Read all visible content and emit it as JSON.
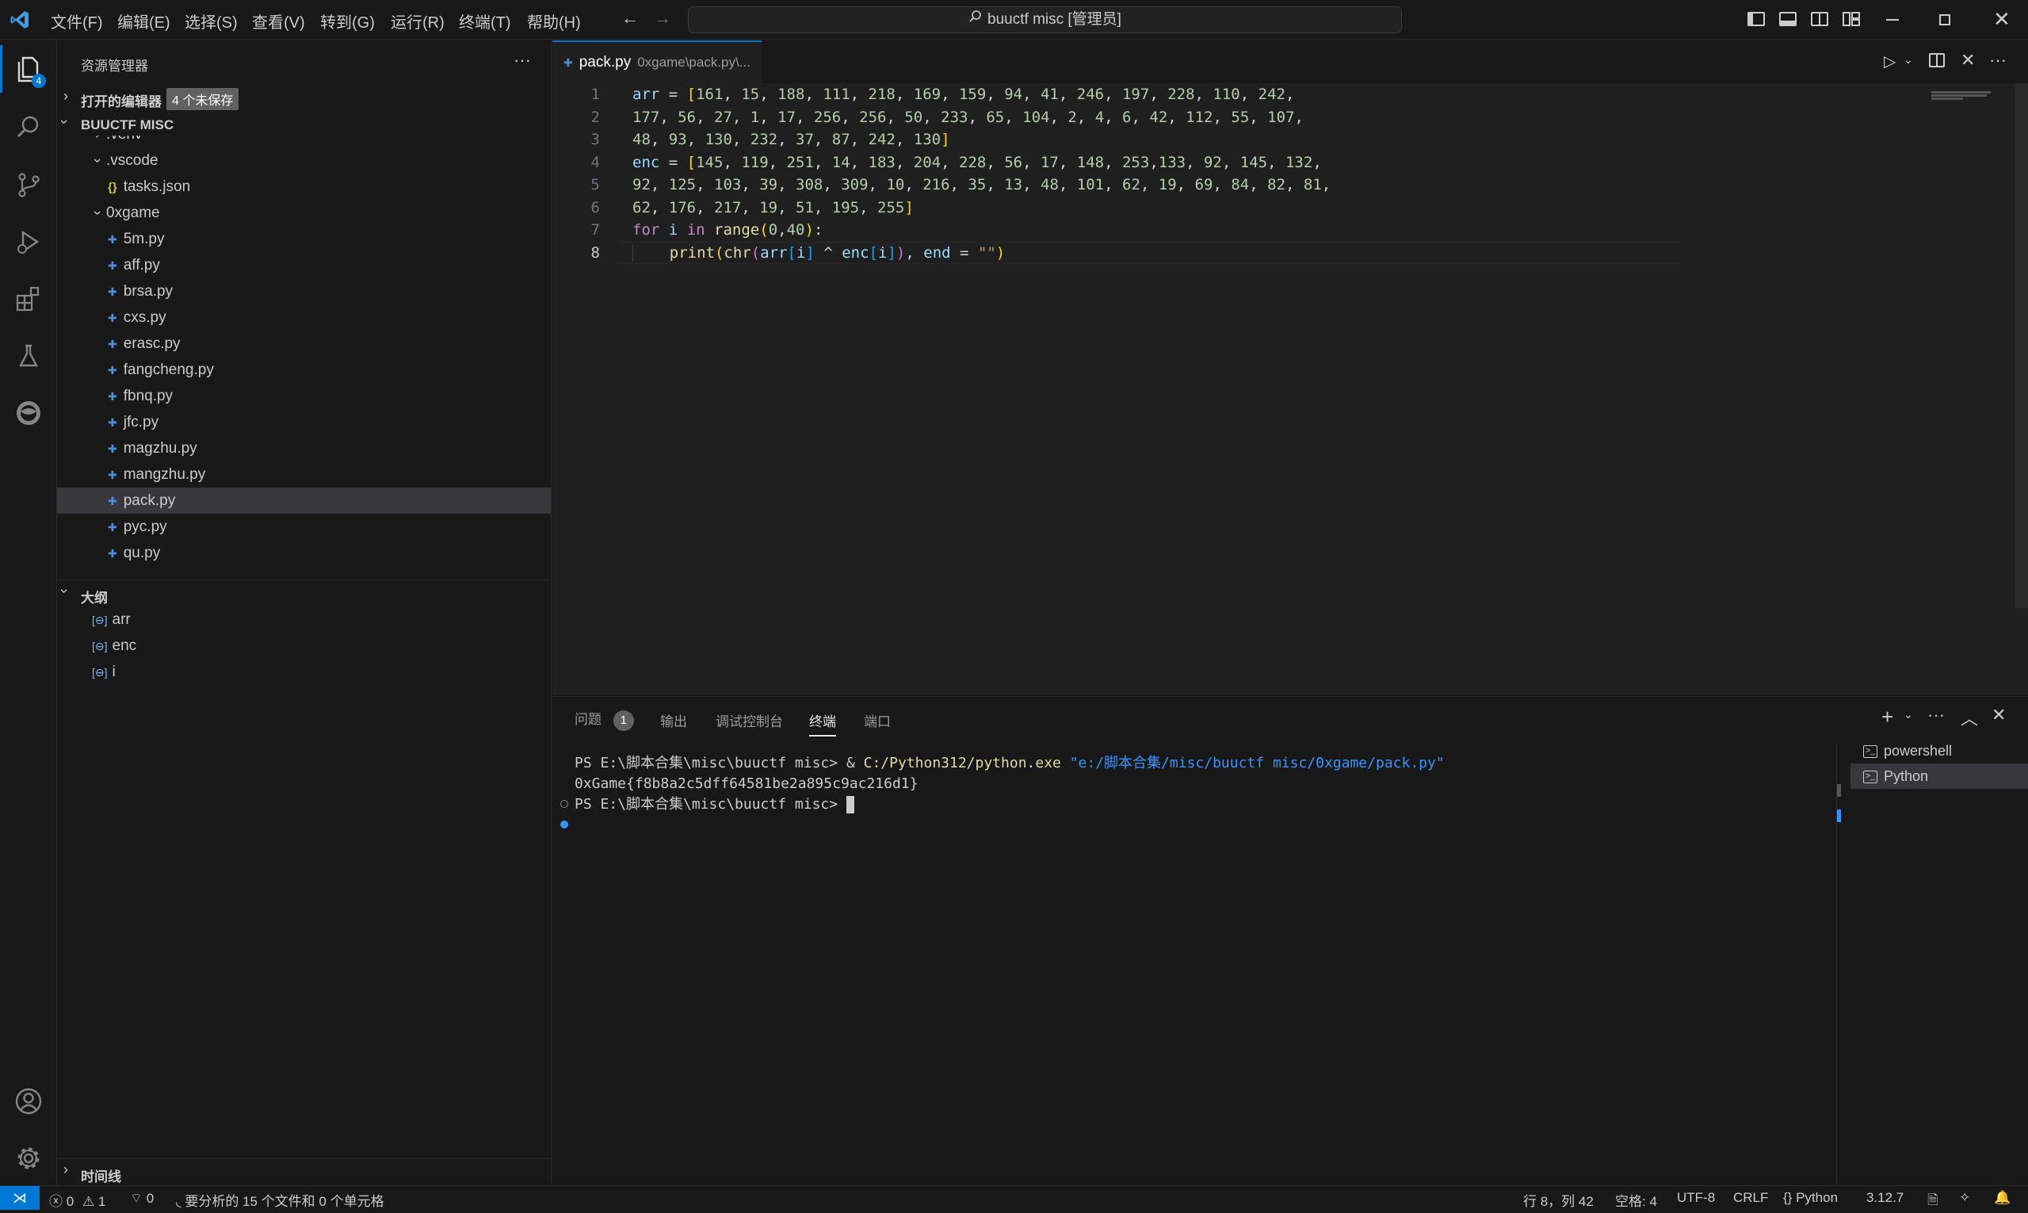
{
  "menu": [
    "文件(F)",
    "编辑(E)",
    "选择(S)",
    "查看(V)",
    "转到(G)",
    "运行(R)",
    "终端(T)",
    "帮助(H)"
  ],
  "command_center": "buuctf misc [管理员]",
  "activity_badge": "4",
  "sidebar": {
    "title": "资源管理器",
    "open_editors": "打开的编辑器",
    "unsaved_badge": "4 个未保存",
    "root": "BUUCTF MISC",
    "tree": [
      {
        "label": ".venv",
        "indent": 0,
        "kind": "folder"
      },
      {
        "label": ".vscode",
        "indent": 0,
        "kind": "folder-open"
      },
      {
        "label": "tasks.json",
        "indent": 1,
        "kind": "json"
      },
      {
        "label": "0xgame",
        "indent": 0,
        "kind": "folder-open"
      },
      {
        "label": "5m.py",
        "indent": 1,
        "kind": "py"
      },
      {
        "label": "aff.py",
        "indent": 1,
        "kind": "py"
      },
      {
        "label": "brsa.py",
        "indent": 1,
        "kind": "py"
      },
      {
        "label": "cxs.py",
        "indent": 1,
        "kind": "py"
      },
      {
        "label": "erasc.py",
        "indent": 1,
        "kind": "py"
      },
      {
        "label": "fangcheng.py",
        "indent": 1,
        "kind": "py"
      },
      {
        "label": "fbnq.py",
        "indent": 1,
        "kind": "py"
      },
      {
        "label": "jfc.py",
        "indent": 1,
        "kind": "py"
      },
      {
        "label": "magzhu.py",
        "indent": 1,
        "kind": "py"
      },
      {
        "label": "mangzhu.py",
        "indent": 1,
        "kind": "py"
      },
      {
        "label": "pack.py",
        "indent": 1,
        "kind": "py",
        "selected": true
      },
      {
        "label": "pyc.py",
        "indent": 1,
        "kind": "py"
      },
      {
        "label": "qu.py",
        "indent": 1,
        "kind": "py"
      }
    ],
    "outline_title": "大纲",
    "outline": [
      "arr",
      "enc",
      "i"
    ],
    "timeline": "时间线"
  },
  "editor": {
    "tab_label": "pack.py",
    "tab_path": "0xgame\\pack.py\\...",
    "active_line": 8,
    "line_numbers": [
      "1",
      "2",
      "3",
      "4",
      "5",
      "6",
      "7",
      "8"
    ]
  },
  "panel": {
    "tabs": [
      "问题",
      "输出",
      "调试控制台",
      "终端",
      "端口"
    ],
    "problems_count": "1",
    "active_tab": "终端",
    "terminal": {
      "prompt1": "PS E:\\脚本合集\\misc\\buuctf misc> ",
      "cmd_amp": "& ",
      "cmd_exe": "C:/Python312/python.exe",
      "cmd_arg": " \"e:/脚本合集/misc/buuctf misc/0xgame/pack.py\"",
      "output": "0xGame{f8b8a2c5dff64581be2a895c9ac216d1}",
      "prompt2": "PS E:\\脚本合集\\misc\\buuctf misc> "
    },
    "terminals": [
      "powershell",
      "Python"
    ]
  },
  "status": {
    "errors": "0",
    "warnings": "1",
    "ports": "0",
    "analysis": "要分析的 15 个文件和 0 个单元格",
    "position": "行 8，列 42",
    "spaces": "空格: 4",
    "encoding": "UTF-8",
    "eol": "CRLF",
    "language": "Python",
    "version": "3.12.7"
  },
  "colors": {
    "accent": "#0078d4",
    "python_icon": "#4d8fd6"
  }
}
